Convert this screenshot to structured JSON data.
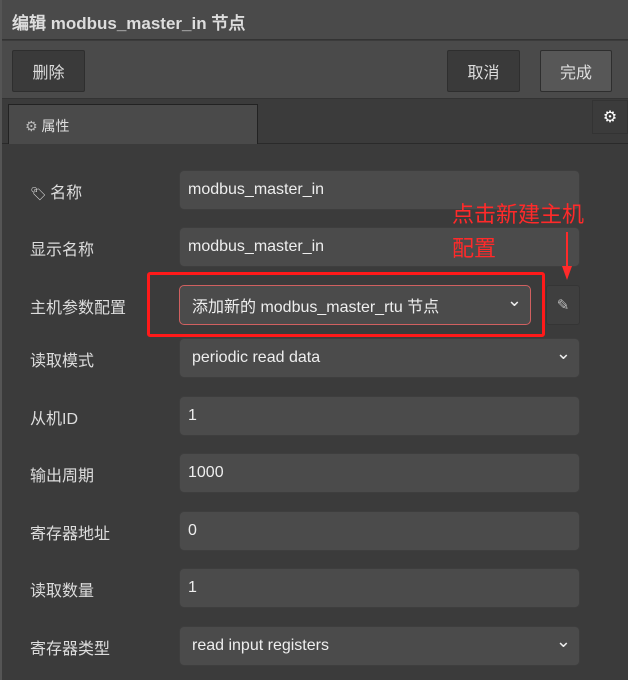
{
  "title": "编辑 modbus_master_in 节点",
  "toolbar": {
    "delete": "删除",
    "cancel": "取消",
    "done": "完成"
  },
  "tabs": [
    {
      "label": "属性",
      "icon": "gear-icon"
    }
  ],
  "form": [
    {
      "label": "名称",
      "value": "modbus_master_in",
      "icon": "tag-icon"
    },
    {
      "label": "显示名称",
      "value": "modbus_master_in"
    },
    {
      "label": "主机参数配置",
      "value": "添加新的 modbus_master_rtu 节点",
      "type": "select"
    },
    {
      "label": "读取模式",
      "value": "periodic read data",
      "type": "select"
    },
    {
      "label": "从机ID",
      "value": "1"
    },
    {
      "label": "输出周期",
      "value": "1000"
    },
    {
      "label": "寄存器地址",
      "value": "0"
    },
    {
      "label": "读取数量",
      "value": "1"
    },
    {
      "label": "寄存器类型",
      "value": "read input registers",
      "type": "select"
    }
  ],
  "annotation": {
    "line1": "点击新建主机",
    "line2": "配置"
  },
  "colors": {
    "annotation": "#ff2a2a"
  }
}
